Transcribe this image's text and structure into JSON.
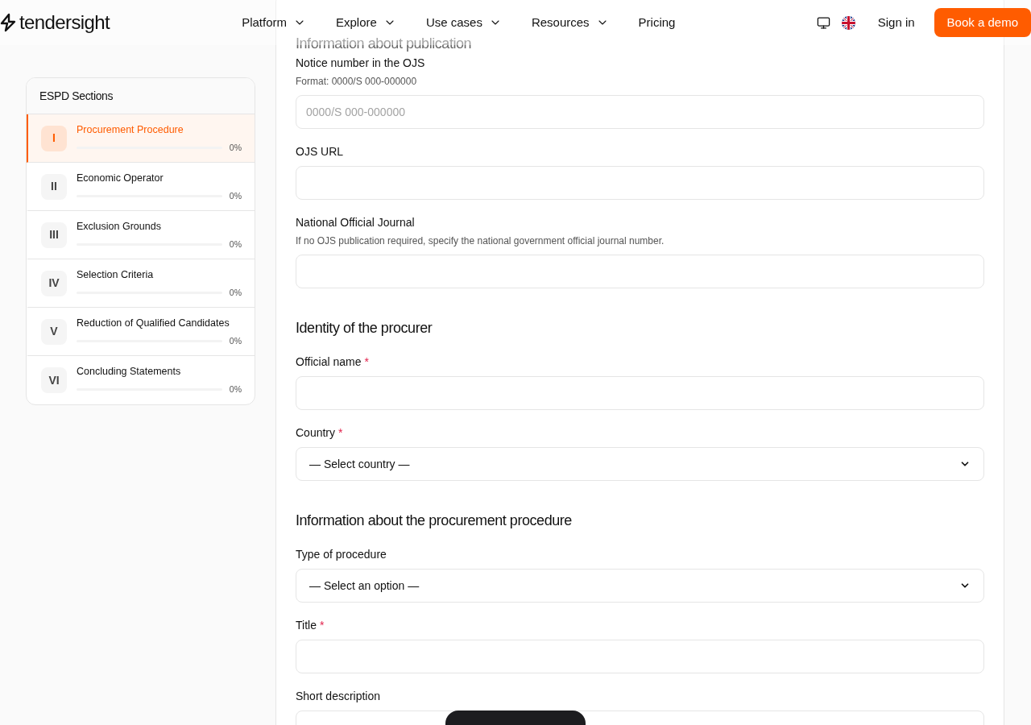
{
  "header": {
    "logo": "tendersight",
    "nav": [
      {
        "label": "Platform",
        "dropdown": true
      },
      {
        "label": "Explore",
        "dropdown": true
      },
      {
        "label": "Use cases",
        "dropdown": true
      },
      {
        "label": "Resources",
        "dropdown": true
      },
      {
        "label": "Pricing",
        "dropdown": false
      }
    ],
    "sign_in": "Sign in",
    "cta": "Book a demo"
  },
  "sidebar": {
    "title": "ESPD Sections",
    "items": [
      {
        "numeral": "I",
        "title": "Procurement Procedure",
        "level": 0,
        "reading": "0%",
        "selected": true
      },
      {
        "numeral": "II",
        "title": "Economic Operator",
        "level": 0,
        "reading": "0%",
        "selected": false
      },
      {
        "numeral": "III",
        "title": "Exclusion Grounds",
        "level": 0,
        "reading": "0%",
        "selected": false
      },
      {
        "numeral": "IV",
        "title": "Selection Criteria",
        "level": 0,
        "reading": "0%",
        "selected": false
      },
      {
        "numeral": "V",
        "title": "Reduction of Qualified Candidates",
        "level": 0,
        "reading": "0%",
        "selected": false
      },
      {
        "numeral": "VI",
        "title": "Concluding Statements",
        "level": 0,
        "reading": "0%",
        "selected": false
      }
    ]
  },
  "form": [
    {
      "kind": "heading",
      "text": "Information about publication"
    },
    {
      "kind": "input",
      "label": "Notice number in the OJS",
      "hint": "Format: 0000/S 000-000000",
      "placeholder": "0000/S 000-000000"
    },
    {
      "kind": "input",
      "label": "OJS URL"
    },
    {
      "kind": "input",
      "label": "National Official Journal",
      "hint": "If no OJS publication required, specify the national government official journal number."
    },
    {
      "kind": "heading",
      "text": "Identity of the procurer"
    },
    {
      "kind": "input",
      "label": "Official name",
      "required_mark": "*"
    },
    {
      "kind": "select",
      "label": "Country",
      "required_mark": "*",
      "value": "— Select country —"
    },
    {
      "kind": "heading",
      "text": "Information about the procurement procedure"
    },
    {
      "kind": "select",
      "label": "Type of procedure",
      "value": "— Select an option —"
    },
    {
      "kind": "input",
      "label": "Title",
      "required_mark": "*"
    },
    {
      "kind": "textarea",
      "label": "Short description"
    }
  ]
}
